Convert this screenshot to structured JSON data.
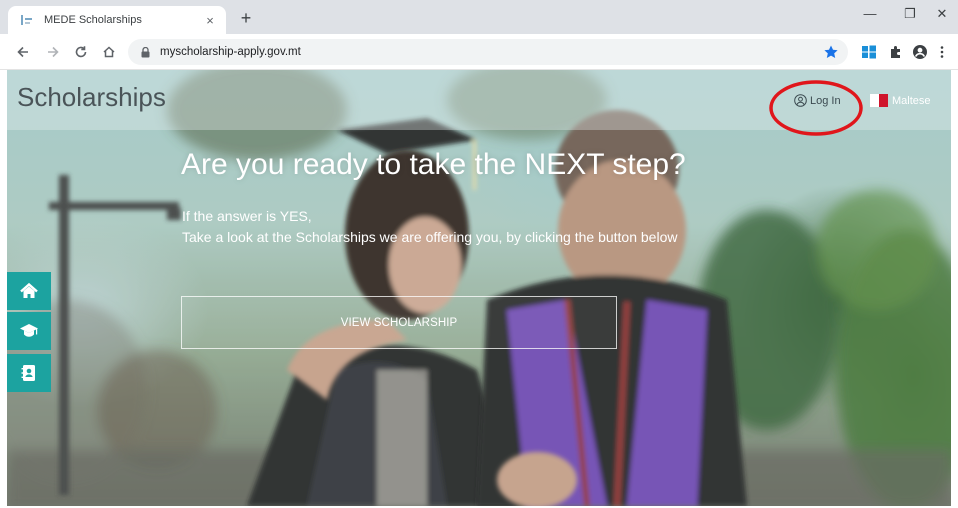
{
  "browser": {
    "tab_title": "MEDE Scholarships",
    "tab_close": "×",
    "new_tab": "+",
    "url": "myscholarship-apply.gov.mt",
    "window_minimize": "—",
    "window_maximize": "❐",
    "window_close": "✕"
  },
  "header": {
    "brand": "Scholarships",
    "login_label": "Log In",
    "language_label": "Maltese"
  },
  "hero": {
    "title": "Are you ready to take the NEXT step?",
    "line1": "If the answer is YES,",
    "line2": "Take a look at the Scholarships we are offering you, by clicking the button below",
    "button_label": "VIEW SCHOLARSHIP"
  },
  "side_nav": {
    "items": [
      {
        "icon": "home-icon"
      },
      {
        "icon": "graduation-cap-icon"
      },
      {
        "icon": "address-book-icon"
      }
    ]
  },
  "colors": {
    "accent": "#1ca3a0",
    "annotation": "#e0161b",
    "flag_red": "#cf142b",
    "flag_white": "#ffffff"
  }
}
